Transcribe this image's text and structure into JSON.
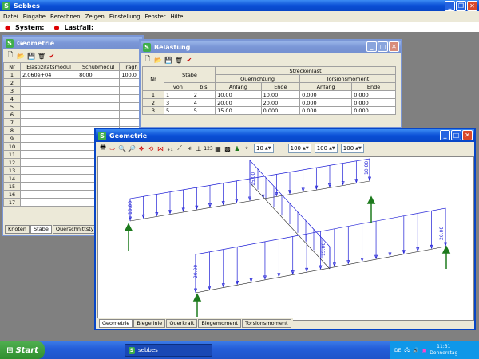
{
  "app": {
    "title": "Sebbes",
    "menu": [
      "Datei",
      "Eingabe",
      "Berechnen",
      "Zeigen",
      "Einstellung",
      "Fenster",
      "Hilfe"
    ],
    "system_label": "System:",
    "lastfall_label": "Lastfall:"
  },
  "geom_left": {
    "title": "Geometrie",
    "headers": [
      "Nr",
      "Elastizitätsmodul",
      "Schubmodul",
      "Trägh"
    ],
    "rows": [
      [
        "1",
        "2.060e+04",
        "8000.",
        "100.0"
      ],
      [
        "2",
        "",
        "",
        ""
      ],
      [
        "3",
        "",
        "",
        ""
      ],
      [
        "4",
        "",
        "",
        ""
      ],
      [
        "5",
        "",
        "",
        ""
      ],
      [
        "6",
        "",
        "",
        ""
      ],
      [
        "7",
        "",
        "",
        ""
      ],
      [
        "8",
        "",
        "",
        ""
      ],
      [
        "9",
        "",
        "",
        ""
      ],
      [
        "10",
        "",
        "",
        ""
      ],
      [
        "11",
        "",
        "",
        ""
      ],
      [
        "12",
        "",
        "",
        ""
      ],
      [
        "13",
        "",
        "",
        ""
      ],
      [
        "14",
        "",
        "",
        ""
      ],
      [
        "15",
        "",
        "",
        ""
      ],
      [
        "16",
        "",
        "",
        ""
      ],
      [
        "17",
        "",
        "",
        ""
      ]
    ],
    "tabs": [
      "Knoten",
      "Stäbe",
      "Querschnittstypen"
    ]
  },
  "belastung": {
    "title": "Belastung",
    "h_nr": "Nr",
    "h_staebe": "Stäbe",
    "h_strecken": "Streckenlast",
    "h_quer": "Querrichtung",
    "h_tors": "Torsionsmoment",
    "h_von": "von",
    "h_bis": "bis",
    "h_anfang": "Anfang",
    "h_ende": "Ende",
    "rows": [
      [
        "1",
        "1",
        "2",
        "10.00",
        "10.00",
        "0.000",
        "0.000"
      ],
      [
        "2",
        "3",
        "4",
        "20.00",
        "20.00",
        "0.000",
        "0.000"
      ],
      [
        "3",
        "5",
        "5",
        "15.00",
        "0.000",
        "0.000",
        "0.000"
      ]
    ]
  },
  "geom_main": {
    "title": "Geometrie",
    "spin1": "10",
    "spin2": "100",
    "spin3": "100",
    "spin4": "100",
    "labels": {
      "l10a": "10.00",
      "l10b": "10.00",
      "l20a": "20.00",
      "l20b": "20.00",
      "l15a": "15.00",
      "l15b": "15.00"
    },
    "tabs": [
      "Geometrie",
      "Biegelinie",
      "Querkraft",
      "Biegemoment",
      "Torsionsmoment"
    ]
  },
  "taskbar": {
    "start": "Start",
    "task": "sebbes",
    "lang": "DE",
    "time": "11:31",
    "day": "Donnerstag"
  },
  "colors": {
    "load": "#1d1dd6",
    "arrow": "#1d7a1d",
    "accent": "#0846c6"
  }
}
